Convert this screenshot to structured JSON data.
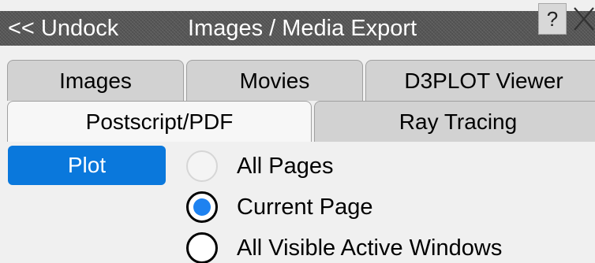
{
  "titlebar": {
    "undock_label": "<< Undock",
    "title": "Images / Media Export",
    "help_label": "?"
  },
  "tabs": {
    "row1": [
      {
        "label": "Images"
      },
      {
        "label": "Movies"
      },
      {
        "label": "D3PLOT Viewer"
      }
    ],
    "row2": [
      {
        "label": "Postscript/PDF",
        "active": true
      },
      {
        "label": "Ray Tracing"
      }
    ]
  },
  "main": {
    "plot_label": "Plot",
    "options": [
      {
        "label": "All Pages",
        "state": "disabled"
      },
      {
        "label": "Current Page",
        "state": "selected"
      },
      {
        "label": "All Visible Active Windows",
        "state": "unselected"
      }
    ]
  },
  "colors": {
    "plot_button": "#0a78dc",
    "radio_selected": "#1e82f0",
    "titlebar": "#565656"
  },
  "icons": {
    "help": "question-mark-icon",
    "close": "close-x-icon"
  }
}
